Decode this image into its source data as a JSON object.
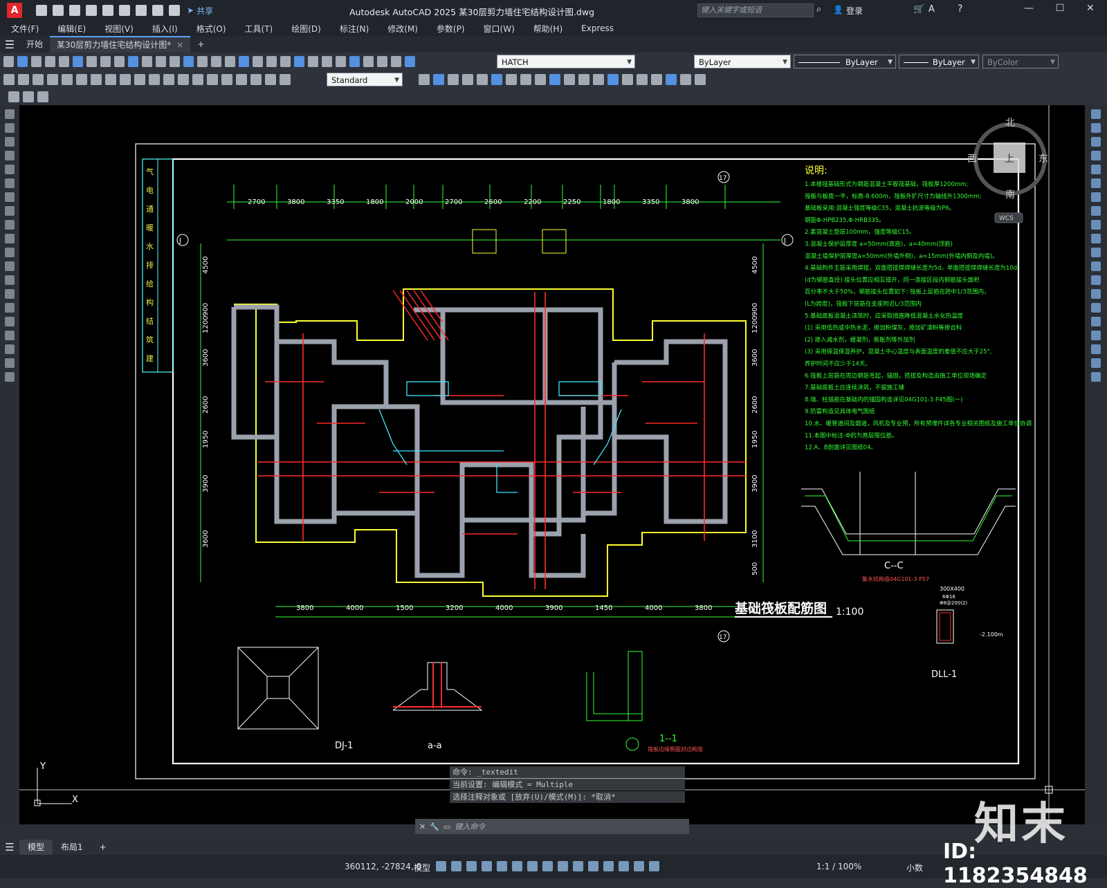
{
  "titlebar": {
    "logo": "A",
    "share": "共享",
    "title": "Autodesk AutoCAD 2025    某30层剪力墙住宅结构设计图.dwg",
    "search_placeholder": "键入关键字或短语",
    "login": "登录"
  },
  "menu": [
    "文件(F)",
    "编辑(E)",
    "视图(V)",
    "插入(I)",
    "格式(O)",
    "工具(T)",
    "绘图(D)",
    "标注(N)",
    "修改(M)",
    "参数(P)",
    "窗口(W)",
    "帮助(H)",
    "Express"
  ],
  "tabs": {
    "start": "开始",
    "doc": "某30层剪力墙住宅结构设计图*",
    "close": "×",
    "add": "+"
  },
  "toolbar": {
    "hatch": "HATCH",
    "layer": "ByLayer",
    "linetype": "ByLayer",
    "lineweight": "ByLayer",
    "color": "ByColor",
    "textstyle": "Standard"
  },
  "drawing": {
    "title": "基础筏板配筋图",
    "scale": "1:100",
    "notes_title": "说明:",
    "notes": [
      "1.本楼筏基础形式为钢筋混凝土平板筏基础，筏板厚1200mm;",
      "  筏板与板底一平，标高-8.600m，筏板外扩尺寸为轴线外1300mm;",
      "  基础板采用:混凝土强度等级C35，混凝土抗渗等级为P6。",
      "  钢筋Φ-HPB235,Φ-HRB335。",
      "2.素混凝土垫层100mm，强度等级C15。",
      "3.混凝土保护层厚度 a=50mm(底筋)，a=40mm(顶筋)",
      "  混凝土墙保护层厚度a=50mm(外墙外侧)，a=15mm(外墙内侧及内墙)。",
      "4.基础构件主筋采用焊接，双面搭接焊焊缝长度为5d，单面搭接焊焊缝长度为10d",
      "  (d为钢筋直径) 接头位置应相互错开，同一连接区段内钢筋接头面积",
      "  百分率不大于50%，钢筋接头位置如下: 筏板上层筋在跨中1/3范围内，",
      "  (L为跨度)，筏板下层筋在支座附近L/3范围内",
      "5.基础底板混凝土浇筑时，应采取措施降低混凝土水化热温度",
      "  (1) 采用低热或中热水泥，掺加粉煤灰，掺加矿渣粉等掺合料",
      "  (2) 掺入减水剂，缓凝剂，膨胀剂等外加剂",
      "  (3) 采用保温保湿养护，混凝土中心温度与表面温度的差值不应大于25°,",
      "      养护时间不应少于14天。",
      "6.筏板上层筋在周边钢筋弯起，锚固，搭接及构造由施工单位现场确定",
      "7.基础底板土应连续浇筑，不留施工缝",
      "8.墙、柱插筋在基础内的锚固构造详见04G101-3 P45图(一)",
      "9.防雷构造见具体电气图纸",
      "10.水、暖管道间及烟道，风机及专业预，所有预埋件详各专业相关图纸及施工单位协调",
      "11.本图中标注-Ф的为高层限位筋。",
      "12.A、B剖面详见图纸04。"
    ],
    "top_dims": [
      "2700",
      "3800",
      "3350",
      "1800",
      "2000",
      "2700",
      "2600",
      "2200",
      "2250",
      "1800",
      "3350",
      "3800"
    ],
    "bottom_dims": [
      "3800",
      "4000",
      "1500",
      "3200",
      "4000",
      "3900",
      "1450",
      "4000",
      "3800"
    ],
    "left_dims": [
      "4500",
      "900",
      "1200",
      "3600",
      "2600",
      "1950",
      "3900",
      "3600"
    ],
    "right_dims": [
      "4500",
      "900",
      "1200",
      "3600",
      "2600",
      "1950",
      "3900",
      "3100",
      "500"
    ],
    "axis_labels": [
      "J",
      "J",
      "17",
      "17"
    ],
    "detail_labels": {
      "dj1": "DJ-1",
      "aa": "a-a",
      "cc": "C--C",
      "cc_note": "集水坑构造04G101-3 P57",
      "sec11": "1--1",
      "sec11_note": "筏板边缘侧面封边构造",
      "dll1": "DLL-1",
      "dll1_size": "300X400",
      "dll1_bars": "6Φ16",
      "dll1_stirrup": "Φ8@200(2)",
      "dll1_elev": "-2.100m"
    },
    "title_block": [
      "建",
      "筑",
      "结",
      "构",
      "给",
      "排",
      "水",
      "暖",
      "通",
      "电",
      "气"
    ],
    "compass": {
      "n": "北",
      "s": "南",
      "e": "东",
      "w": "西",
      "top": "上",
      "wcs": "WCS"
    }
  },
  "command": {
    "history": [
      "命令: _textedit",
      "当前设置: 编辑模式 = Multiple",
      "选择注释对象或 [放弃(U)/模式(M)]: *取消*"
    ],
    "input_placeholder": "键入命令"
  },
  "layouts": {
    "model": "模型",
    "layout1": "布局1",
    "add": "+"
  },
  "status": {
    "coords": "360112, -27824, 0",
    "mode": "模型",
    "scale": "1:1 / 100%",
    "units": "小数"
  },
  "watermark": {
    "id": "ID: 1182354848",
    "logo": "知末"
  }
}
